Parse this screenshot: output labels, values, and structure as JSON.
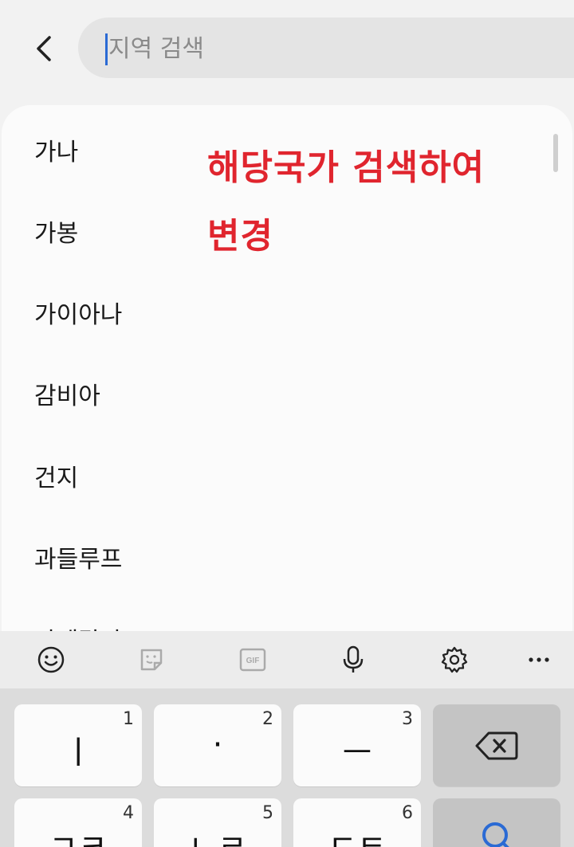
{
  "search": {
    "placeholder": "지역 검색",
    "value": ""
  },
  "regions": [
    "가나",
    "가봉",
    "가이아나",
    "감비아",
    "건지",
    "과들루프",
    "과테말라"
  ],
  "annotation": {
    "line1": "해당국가 검색하여",
    "line2": "변경",
    "color": "#e0252e"
  },
  "keyboard_toolbar": {
    "icons": [
      "emoji-icon",
      "sticker-icon",
      "gif-icon",
      "microphone-icon",
      "settings-icon",
      "more-icon"
    ],
    "gif_label": "GIF"
  },
  "keys": {
    "row1": [
      {
        "num": "1",
        "main": "ㅣ"
      },
      {
        "num": "2",
        "main": "·"
      },
      {
        "num": "3",
        "main": "ㅡ"
      }
    ],
    "row2": [
      {
        "num": "4",
        "main": "ㄱㅋ"
      },
      {
        "num": "5",
        "main": "ㄴㄹ"
      },
      {
        "num": "6",
        "main": "ㄷㅌ"
      }
    ]
  },
  "colors": {
    "accent": "#2a6ad4",
    "annotation": "#e0252e"
  }
}
